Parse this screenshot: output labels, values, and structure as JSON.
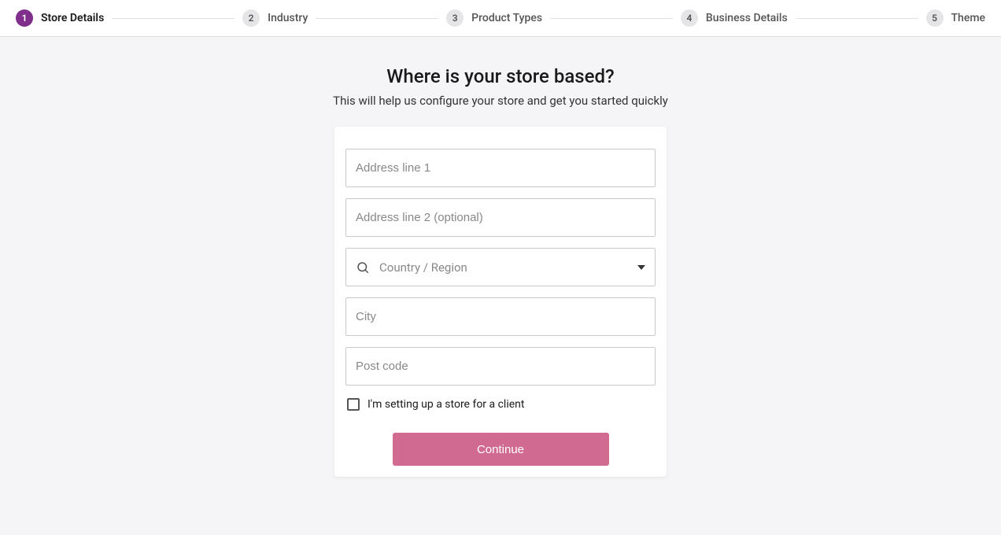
{
  "stepper": {
    "steps": [
      {
        "num": "1",
        "label": "Store Details",
        "active": true
      },
      {
        "num": "2",
        "label": "Industry",
        "active": false
      },
      {
        "num": "3",
        "label": "Product Types",
        "active": false
      },
      {
        "num": "4",
        "label": "Business Details",
        "active": false
      },
      {
        "num": "5",
        "label": "Theme",
        "active": false
      }
    ]
  },
  "header": {
    "title": "Where is your store based?",
    "subtitle": "This will help us configure your store and get you started quickly"
  },
  "form": {
    "address1_placeholder": "Address line 1",
    "address2_placeholder": "Address line 2 (optional)",
    "country_placeholder": "Country / Region",
    "city_placeholder": "City",
    "postcode_placeholder": "Post code",
    "client_checkbox_label": "I'm setting up a store for a client",
    "continue_label": "Continue"
  }
}
